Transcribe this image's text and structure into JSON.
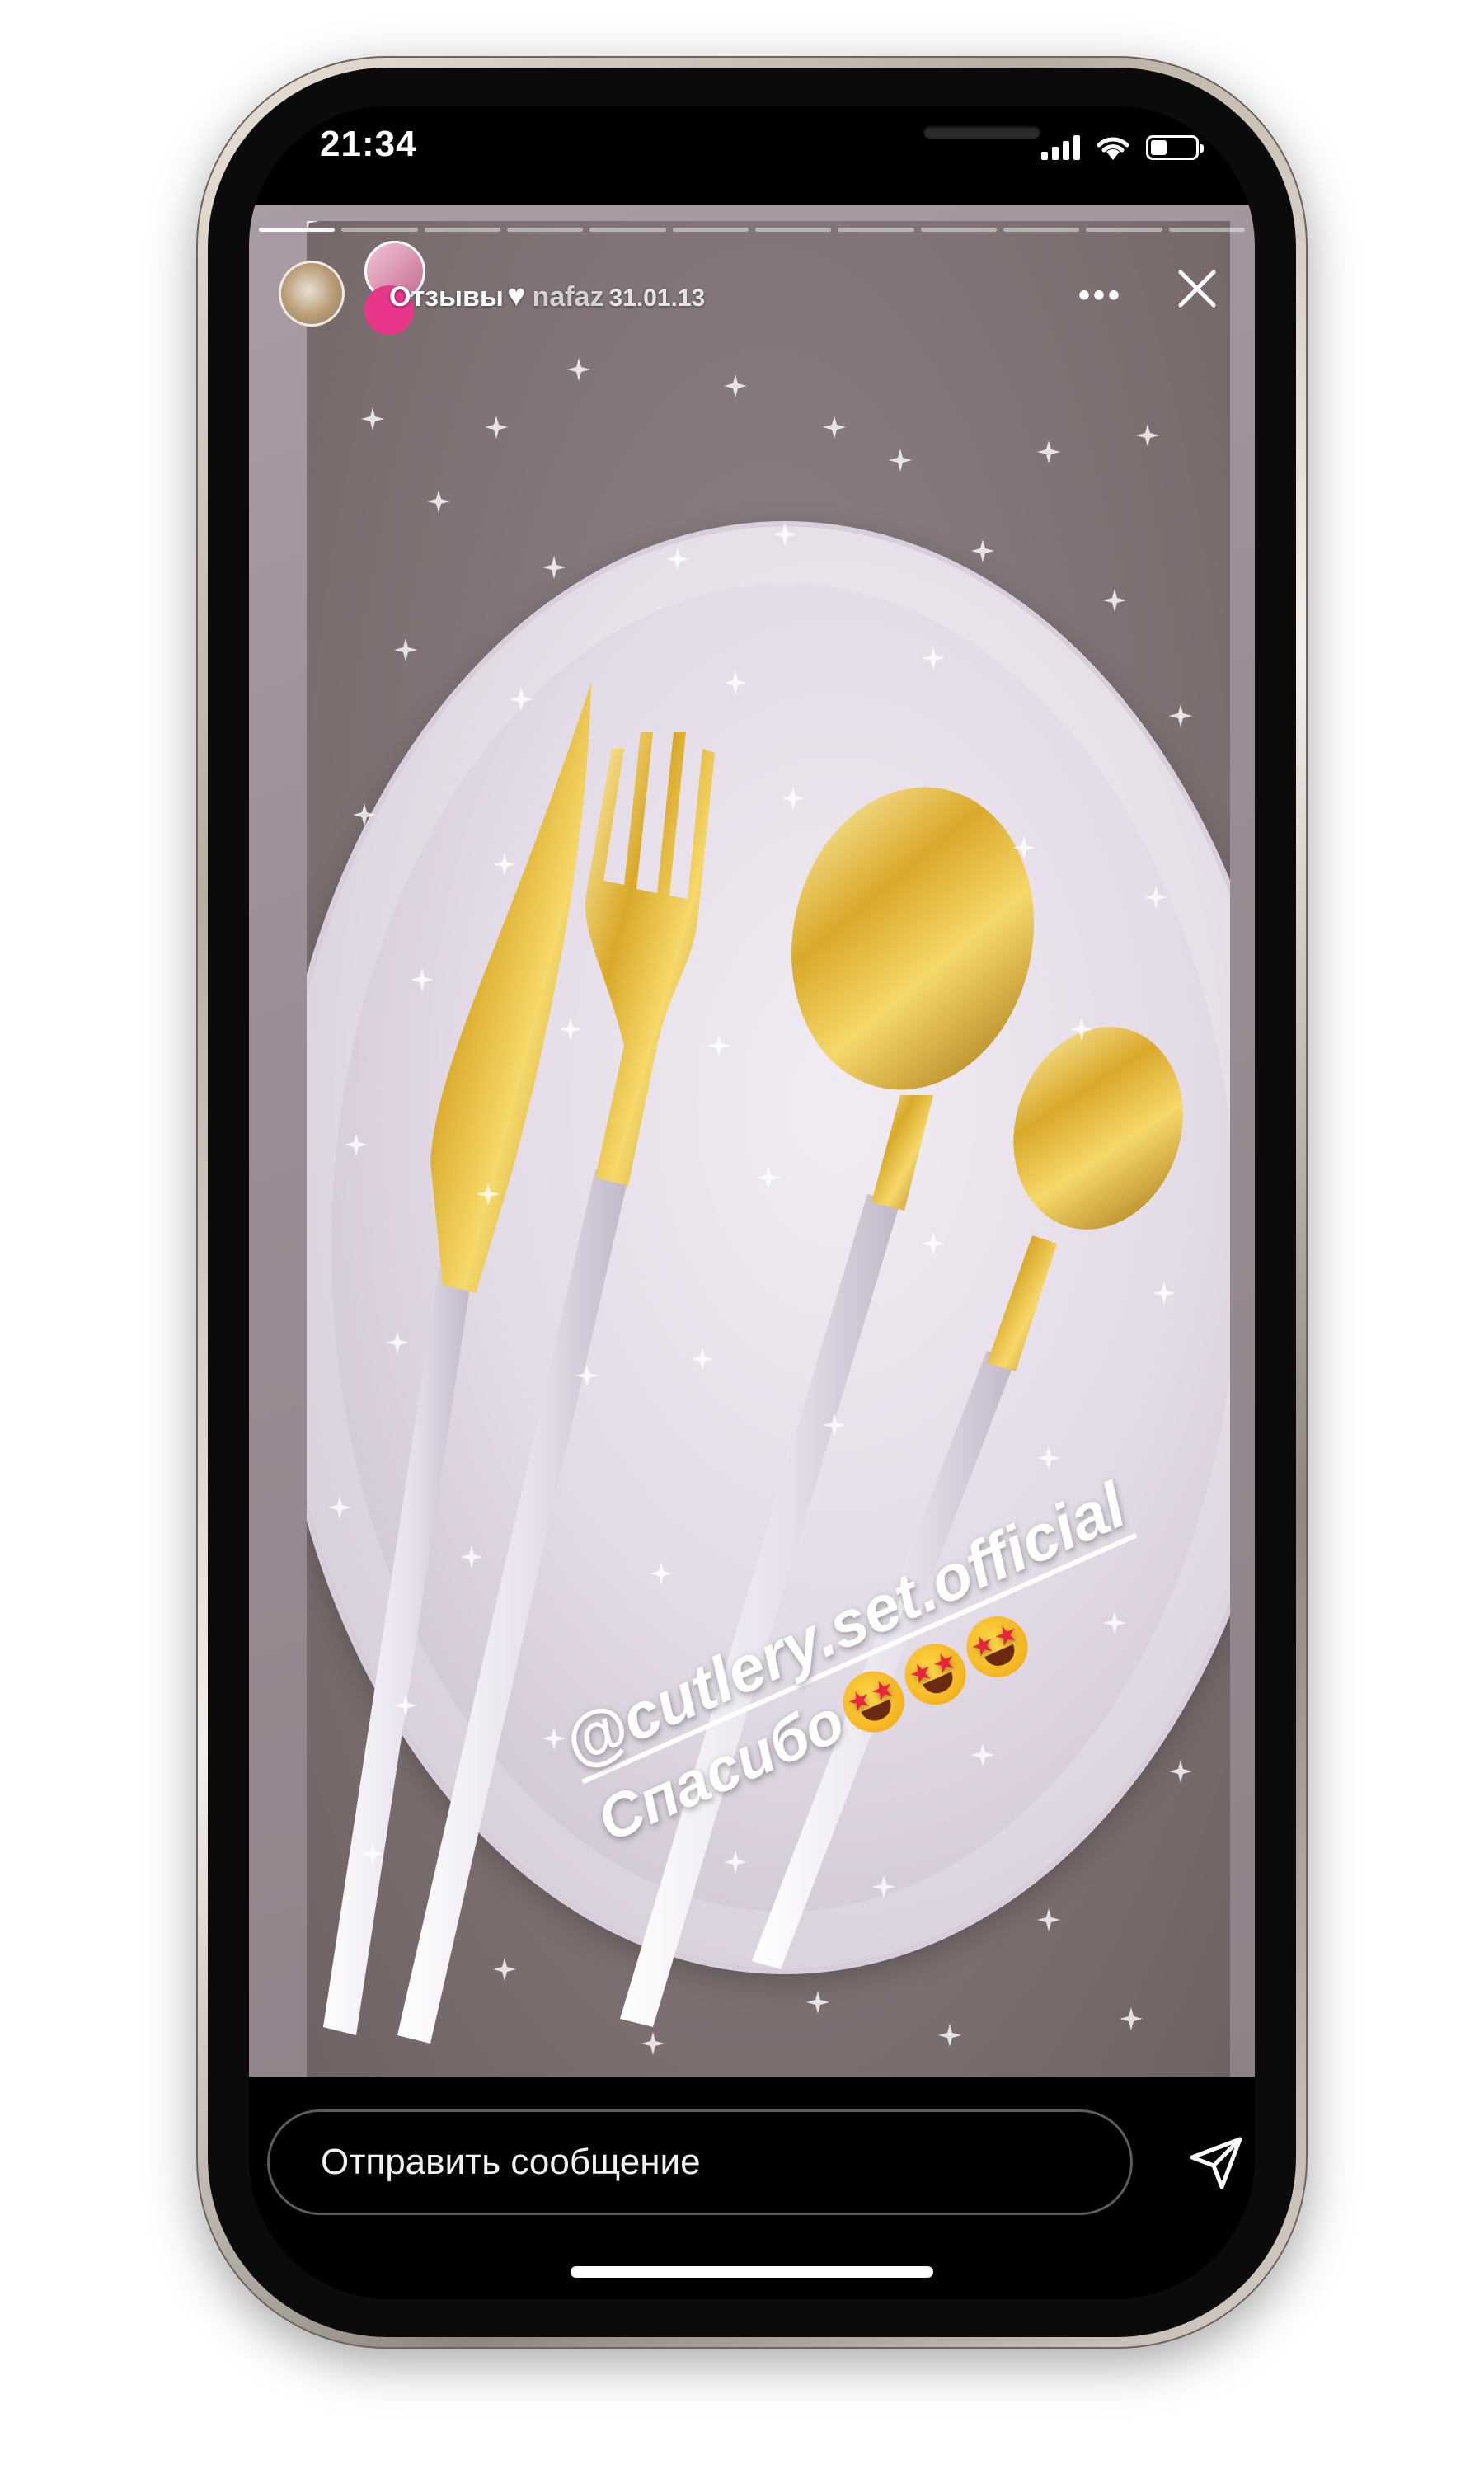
{
  "status_bar": {
    "time": "21:34",
    "battery_level": 0.36
  },
  "story": {
    "highlight_title": "Отзывы",
    "username_fragment": "nafaz",
    "timestamp_fragment": "31.01.13",
    "progress_segments": {
      "total": 12,
      "completed": 1
    },
    "mention": "@cutlery.set.official",
    "caption": "Спасибо",
    "emoji_count": 3,
    "emoji_name": "star-struck"
  },
  "message_bar": {
    "placeholder": "Отправить сообщение"
  },
  "icons": {
    "more": "more-icon",
    "close": "close-icon",
    "send": "send-icon",
    "heart": "heart-icon"
  },
  "colors": {
    "gold": "#d4a62a",
    "plate": "#e8e0ea",
    "handle": "#ece8f0",
    "screen_bg": "#000000"
  }
}
